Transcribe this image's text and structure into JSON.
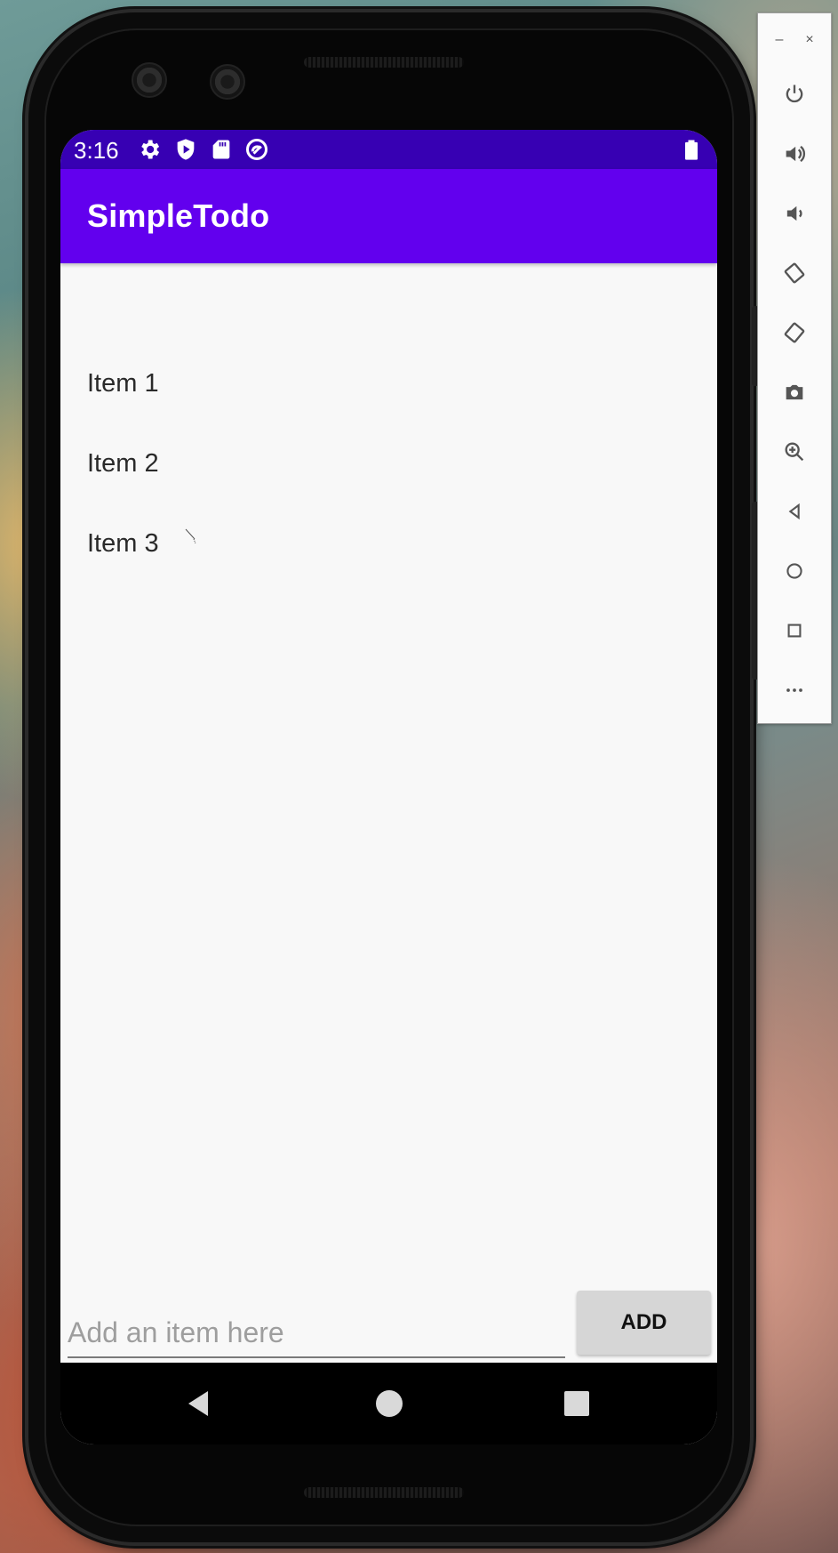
{
  "emulator_toolbar": {
    "minimize_label": "–",
    "close_label": "×",
    "buttons": [
      {
        "icon": "power-icon"
      },
      {
        "icon": "volume-up-icon"
      },
      {
        "icon": "volume-down-icon"
      },
      {
        "icon": "rotate-left-icon"
      },
      {
        "icon": "rotate-right-icon"
      },
      {
        "icon": "camera-icon"
      },
      {
        "icon": "zoom-icon"
      },
      {
        "icon": "back-icon"
      },
      {
        "icon": "home-icon"
      },
      {
        "icon": "overview-icon"
      },
      {
        "icon": "more-icon"
      }
    ]
  },
  "status_bar": {
    "time": "3:16",
    "icons": [
      "settings-icon",
      "shield-icon",
      "sd-card-icon",
      "sync-icon",
      "battery-icon"
    ]
  },
  "app_bar": {
    "title": "SimpleTodo",
    "color": "#6200ee",
    "status_color": "#3700b3"
  },
  "todo_list": {
    "items": [
      "Item 1",
      "Item 2",
      "Item 3"
    ]
  },
  "input": {
    "value": "",
    "placeholder": "Add an item here"
  },
  "add_button": {
    "label": "ADD"
  },
  "nav_bar": {
    "icons": [
      "nav-back-icon",
      "nav-home-icon",
      "nav-recents-icon"
    ]
  }
}
